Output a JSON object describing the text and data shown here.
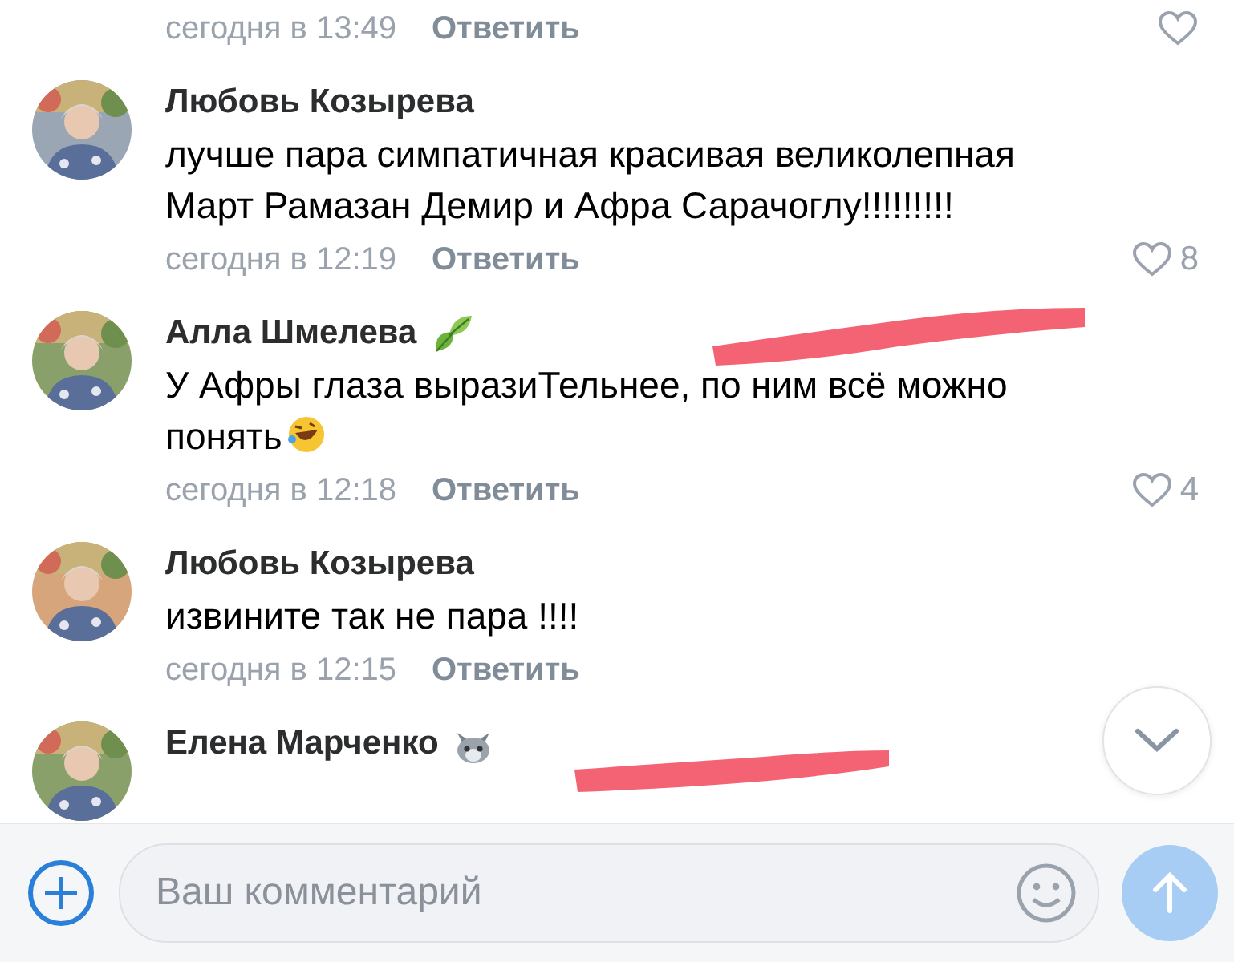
{
  "comments": [
    {
      "time": "сегодня в 13:49",
      "reply": "Ответить",
      "liked": false
    },
    {
      "author": "Любовь Козырева",
      "text": "лучше пара симпатичная красивая великолепная Март Рамазан Демир и Афра Сарачоглу!!!!!!!!!",
      "time": "сегодня в 12:19",
      "reply": "Ответить",
      "liked": false,
      "likes": "8"
    },
    {
      "author": "Алла Шмелева",
      "badge": {
        "kind": "leaf"
      },
      "text": "У Афры глаза выразиТельнее, по ним всё можно понять",
      "emoji": true,
      "time": "сегодня в 12:18",
      "reply": "Ответить",
      "liked": false,
      "likes": "4"
    },
    {
      "author": "Любовь Козырева",
      "text": "извините так не пара !!!!",
      "time": "сегодня в 12:15",
      "reply": "Ответить"
    },
    {
      "author": "Елена Марченко",
      "badge": {
        "kind": "cat"
      }
    }
  ],
  "composer": {
    "placeholder": "Ваш комментарий"
  }
}
